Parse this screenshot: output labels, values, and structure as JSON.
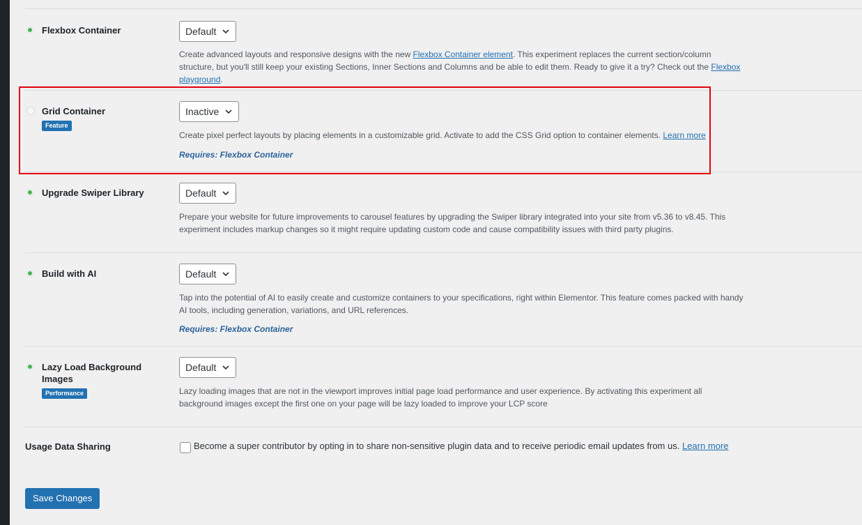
{
  "experiments": [
    {
      "title": "Flexbox Container",
      "status": "active",
      "select_value": "Default",
      "desc_before": "Create advanced layouts and responsive designs with the new ",
      "desc_link1": "Flexbox Container element",
      "desc_middle": ". This experiment replaces the current section/column structure, but you'll still keep your existing Sections, Inner Sections and Columns and be able to edit them. Ready to give it a try? Check out the ",
      "desc_link2": "Flexbox playground",
      "desc_after": "."
    },
    {
      "title": "Grid Container",
      "status": "inactive",
      "badge": "Feature",
      "select_value": "Inactive",
      "desc_before": "Create pixel perfect layouts by placing elements in a customizable grid. Activate to add the CSS Grid option to container elements. ",
      "desc_link1": "Learn more",
      "requires": "Requires: Flexbox Container"
    },
    {
      "title": "Upgrade Swiper Library",
      "status": "active",
      "select_value": "Default",
      "desc_before": "Prepare your website for future improvements to carousel features by upgrading the Swiper library integrated into your site from v5.36 to v8.45. This experiment includes markup changes so it might require updating custom code and cause compatibility issues with third party plugins."
    },
    {
      "title": "Build with AI",
      "status": "active",
      "select_value": "Default",
      "desc_before": "Tap into the potential of AI to easily create and customize containers to your specifications, right within Elementor. This feature comes packed with handy AI tools, including generation, variations, and URL references.",
      "requires": "Requires: Flexbox Container"
    },
    {
      "title": "Lazy Load Background Images",
      "status": "active",
      "badge": "Performance",
      "select_value": "Default",
      "desc_before": "Lazy loading images that are not in the viewport improves initial page load performance and user experience. By activating this experiment all background images except the first one on your page will be lazy loaded to improve your LCP score"
    }
  ],
  "usage": {
    "label": "Usage Data Sharing",
    "text": "Become a super contributor by opting in to share non-sensitive plugin data and to receive periodic email updates from us. ",
    "link": "Learn more"
  },
  "save_label": "Save Changes",
  "colors": {
    "active_dot": "#46b450",
    "accent": "#2271b1",
    "highlight_border": "#e3000b"
  }
}
